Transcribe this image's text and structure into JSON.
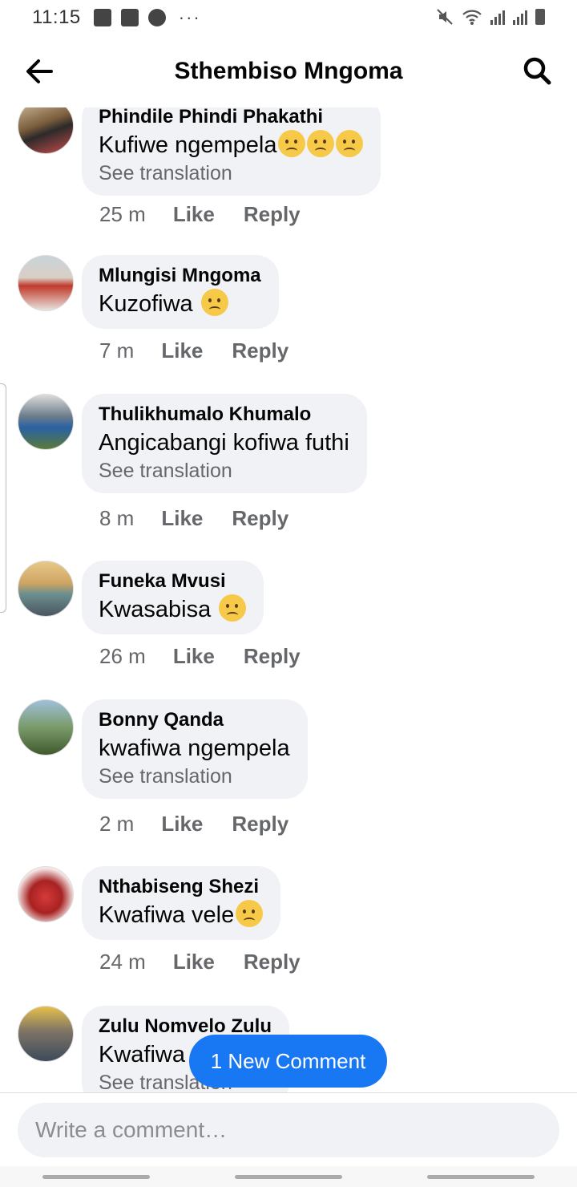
{
  "status_bar": {
    "time": "11:15",
    "more": "···"
  },
  "header": {
    "title": "Sthembiso Mngoma"
  },
  "comments": [
    {
      "author": "Phindile Phindi Phakathi",
      "text": "Kufiwe ngempela",
      "translation": "See translation",
      "time": "25 m",
      "like": "Like",
      "reply": "Reply"
    },
    {
      "author": "Mlungisi Mngoma",
      "text": "Kuzofiwa",
      "time": "7 m",
      "like": "Like",
      "reply": "Reply"
    },
    {
      "author": "Thulikhumalo Khumalo",
      "text": "Angicabangi kofiwa futhi",
      "translation": "See translation",
      "time": "8 m",
      "like": "Like",
      "reply": "Reply"
    },
    {
      "author": "Funeka Mvusi",
      "text": "Kwasabisa",
      "time": "26 m",
      "like": "Like",
      "reply": "Reply"
    },
    {
      "author": "Bonny Qanda",
      "text": "kwafiwa ngempela",
      "translation": "See translation",
      "time": "2 m",
      "like": "Like",
      "reply": "Reply"
    },
    {
      "author": "Nthabiseng Shezi",
      "text": "Kwafiwa vele",
      "time": "24 m",
      "like": "Like",
      "reply": "Reply"
    },
    {
      "author": "Zulu Nomvelo Zulu",
      "text": "Kwafiwa",
      "translation": "See translation"
    }
  ],
  "new_comment_pill": "1 New Comment",
  "composer": {
    "placeholder": "Write a comment…"
  },
  "colors": {
    "accent": "#1877f2",
    "bubble": "#f0f2f5",
    "muted": "#65676b"
  }
}
